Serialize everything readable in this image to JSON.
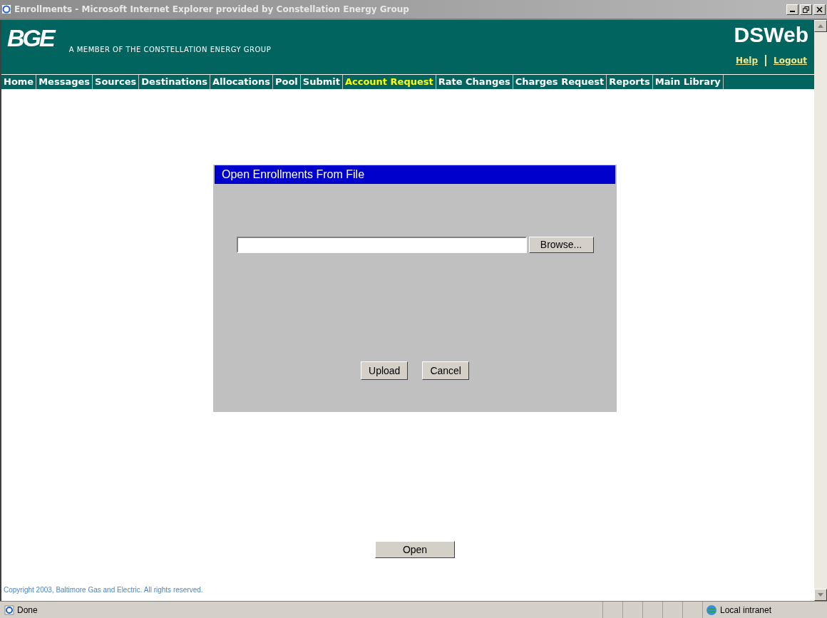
{
  "window": {
    "title": "Enrollments - Microsoft Internet Explorer provided by Constellation Energy Group"
  },
  "header": {
    "logo": "BGE",
    "tagline": "A MEMBER OF THE CONSTELLATION ENERGY GROUP",
    "app_name": "DSWeb",
    "links": [
      "Help",
      "Logout"
    ]
  },
  "nav": [
    {
      "label": "Home",
      "selected": false
    },
    {
      "label": "Messages",
      "selected": false
    },
    {
      "label": "Sources",
      "selected": false
    },
    {
      "label": "Destinations",
      "selected": false
    },
    {
      "label": "Allocations",
      "selected": false
    },
    {
      "label": "Pool",
      "selected": false
    },
    {
      "label": "Submit",
      "selected": false
    },
    {
      "label": "Account Request",
      "selected": true
    },
    {
      "label": "Rate Changes",
      "selected": false
    },
    {
      "label": "Charges Request",
      "selected": false
    },
    {
      "label": "Reports",
      "selected": false
    },
    {
      "label": "Main Library",
      "selected": false
    }
  ],
  "dialog": {
    "title": "Open Enrollments From File",
    "browse_button": "Browse...",
    "buttons": [
      "Upload",
      "Cancel"
    ]
  },
  "open_button": "Open",
  "footer": "Copyright 2003, Baltimore Gas and Electric. All rights reserved.",
  "status_bar": {
    "status": "Done",
    "zone": "Local intranet"
  }
}
